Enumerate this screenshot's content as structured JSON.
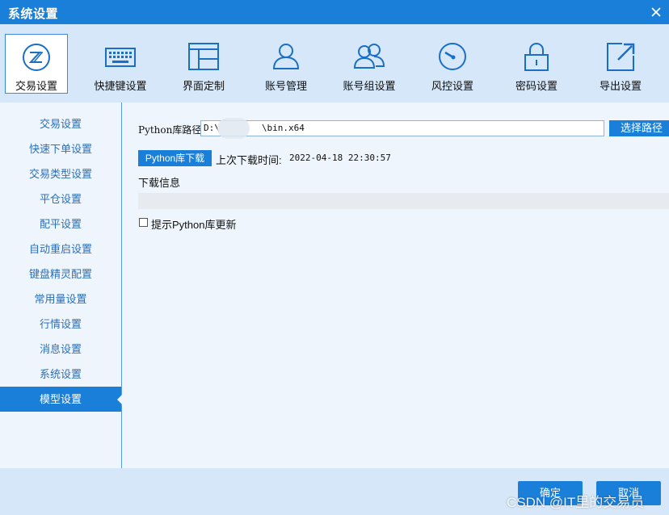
{
  "window": {
    "title": "系统设置",
    "close_icon": "close-icon"
  },
  "toolbar": {
    "items": [
      {
        "label": "交易设置",
        "icon": "trade-icon",
        "active": true
      },
      {
        "label": "快捷键设置",
        "icon": "keyboard-icon",
        "active": false
      },
      {
        "label": "界面定制",
        "icon": "layout-icon",
        "active": false
      },
      {
        "label": "账号管理",
        "icon": "user-icon",
        "active": false
      },
      {
        "label": "账号组设置",
        "icon": "user-group-icon",
        "active": false
      },
      {
        "label": "风控设置",
        "icon": "gauge-icon",
        "active": false
      },
      {
        "label": "密码设置",
        "icon": "lock-icon",
        "active": false
      },
      {
        "label": "导出设置",
        "icon": "export-icon",
        "active": false
      }
    ]
  },
  "sidebar": {
    "items": [
      {
        "label": "交易设置"
      },
      {
        "label": "快速下单设置"
      },
      {
        "label": "交易类型设置"
      },
      {
        "label": "平仓设置"
      },
      {
        "label": "配平设置"
      },
      {
        "label": "自动重启设置"
      },
      {
        "label": "键盘精灵配置"
      },
      {
        "label": "常用量设置"
      },
      {
        "label": "行情设置"
      },
      {
        "label": "消息设置"
      },
      {
        "label": "系统设置"
      },
      {
        "label": "模型设置",
        "active": true
      }
    ]
  },
  "main": {
    "path_label": "Python库路径",
    "path_value_prefix": "D:\\",
    "path_value_suffix": "\\bin.x64",
    "select_path_button": "选择路径",
    "download_button": "Python库下载",
    "last_download_label": "上次下载时间:",
    "last_download_value": "2022-04-18 22:30:57",
    "download_info_label": "下载信息",
    "prompt_update_label": "提示Python库更新",
    "prompt_update_checked": false
  },
  "footer": {
    "ok_button": "确定",
    "cancel_button": "取消",
    "watermark": "CSDN @IT里的交易员"
  },
  "colors": {
    "accent": "#1a7fd9",
    "toolbar_bg": "#d5e7f8",
    "panel_bg": "#eef5fc"
  }
}
